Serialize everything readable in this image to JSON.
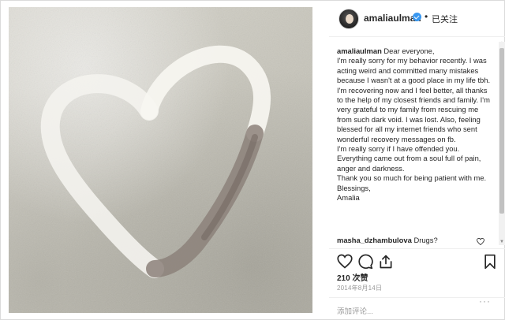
{
  "post": {
    "username": "amaliaulman",
    "follow_status": "已关注",
    "separator": "•",
    "caption_lines": [
      "Dear everyone,",
      "I'm really sorry for my behavior recently. I was acting weird and committed many mistakes because I wasn't at a good place in my life tbh.",
      "I'm recovering now and I feel better, all thanks to the help of my closest friends and family. I'm very grateful to my family from rescuing me from such dark void. I was lost. Also, feeling blessed for all my internet friends who sent wonderful recovery messages on fb.",
      "I'm really sorry if I have offended you. Everything came out from a soul full of pain, anger and darkness.",
      "Thank you so much for being patient with me.",
      "Blessings,",
      "Amalia"
    ],
    "comment": {
      "username": "masha_dzhambulova",
      "text": "Drugs?"
    },
    "likes": "210 次赞",
    "date": "2014年8月14日",
    "add_comment_placeholder": "添加评论...",
    "more_label": "···"
  },
  "icons": {
    "like": "heart-outline-icon",
    "comment": "comment-bubble-icon",
    "share": "share-icon",
    "save": "bookmark-icon",
    "verified": "verified-badge-icon"
  },
  "colors": {
    "verified_blue": "#3897f0",
    "text": "#262626",
    "muted": "#999999"
  }
}
